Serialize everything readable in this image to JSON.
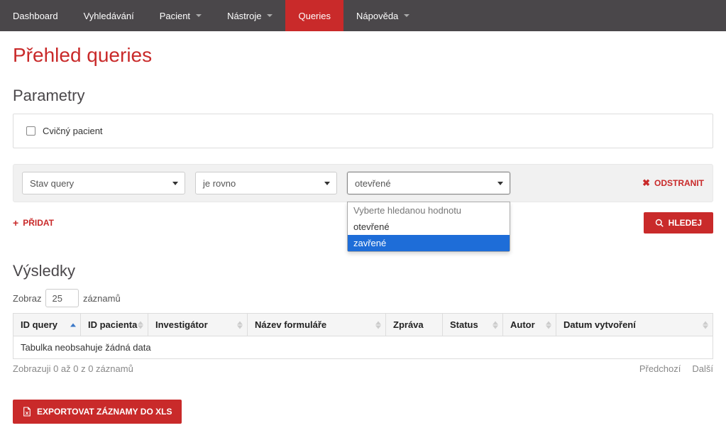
{
  "nav": {
    "items": [
      {
        "label": "Dashboard",
        "caret": false
      },
      {
        "label": "Vyhledávání",
        "caret": false
      },
      {
        "label": "Pacient",
        "caret": true
      },
      {
        "label": "Nástroje",
        "caret": true
      },
      {
        "label": "Queries",
        "caret": false,
        "active": true
      },
      {
        "label": "Nápověda",
        "caret": true
      }
    ]
  },
  "page": {
    "title": "Přehled queries"
  },
  "params": {
    "heading": "Parametry",
    "checkbox_label": "Cvičný pacient",
    "field_select": "Stav query",
    "operator_select": "je rovno",
    "value_select": "otevřené",
    "value_options": {
      "placeholder": "Vyberte hledanou hodnotu",
      "opt1": "otevřené",
      "opt2": "zavřené"
    },
    "remove_label": "ODSTRANIT",
    "add_label": "PŘIDAT",
    "search_label": "HLEDEJ"
  },
  "results": {
    "heading": "Výsledky",
    "length_prefix": "Zobraz",
    "length_value": "25",
    "length_suffix": "záznamů",
    "columns": {
      "c0": "ID query",
      "c1": "ID pacienta",
      "c2": "Investigátor",
      "c3": "Název formuláře",
      "c4": "Zpráva",
      "c5": "Status",
      "c6": "Autor",
      "c7": "Datum vytvoření"
    },
    "empty_text": "Tabulka neobsahuje žádná data",
    "info_text": "Zobrazuji 0 až 0 z 0 záznamů",
    "prev": "Předchozí",
    "next": "Další"
  },
  "export": {
    "label": "EXPORTOVAT ZÁZNAMY DO XLS"
  }
}
